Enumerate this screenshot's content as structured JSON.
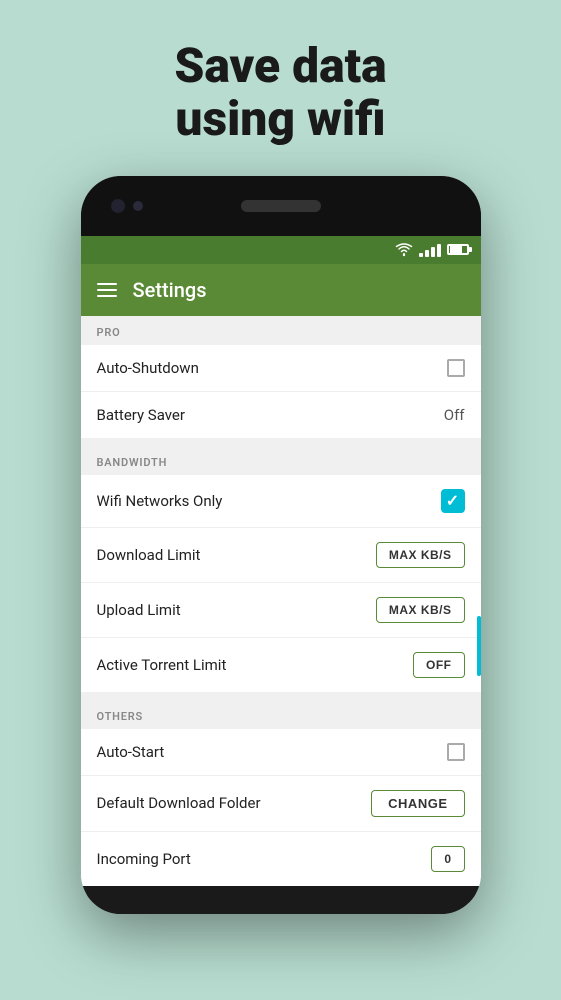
{
  "hero": {
    "title_line1": "Save data",
    "title_line2": "using wifi"
  },
  "status_bar": {
    "icons": [
      "wifi",
      "signal",
      "battery"
    ]
  },
  "toolbar": {
    "title": "Settings"
  },
  "sections": [
    {
      "id": "pro",
      "header": "PRO",
      "items": [
        {
          "label": "Auto-Shutdown",
          "control": "checkbox",
          "checked": false
        },
        {
          "label": "Battery Saver",
          "control": "value",
          "value": "Off"
        }
      ]
    },
    {
      "id": "bandwidth",
      "header": "BANDWIDTH",
      "items": [
        {
          "label": "Wifi Networks Only",
          "control": "checkbox-checked",
          "checked": true
        },
        {
          "label": "Download Limit",
          "control": "button",
          "button_text": "MAX KB/S"
        },
        {
          "label": "Upload Limit",
          "control": "button",
          "button_text": "MAX KB/S"
        },
        {
          "label": "Active Torrent Limit",
          "control": "button",
          "button_text": "OFF"
        }
      ]
    },
    {
      "id": "others",
      "header": "OTHERS",
      "items": [
        {
          "label": "Auto-Start",
          "control": "checkbox",
          "checked": false
        },
        {
          "label": "Default Download Folder",
          "control": "change-button",
          "button_text": "CHANGE"
        },
        {
          "label": "Incoming Port",
          "control": "button",
          "button_text": "0"
        }
      ]
    }
  ]
}
